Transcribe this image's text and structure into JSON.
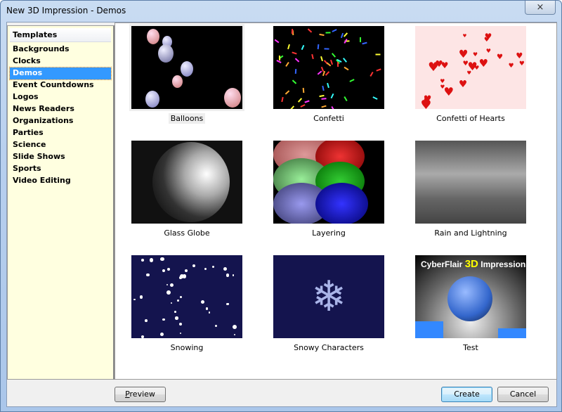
{
  "window": {
    "title": "New 3D Impression - Demos",
    "close_icon": "×"
  },
  "sidebar": {
    "header": "Templates",
    "selected": "Demos",
    "items": [
      {
        "label": "Backgrounds"
      },
      {
        "label": "Clocks"
      },
      {
        "label": "Demos"
      },
      {
        "label": "Event Countdowns"
      },
      {
        "label": "Logos"
      },
      {
        "label": "News Readers"
      },
      {
        "label": "Organizations"
      },
      {
        "label": "Parties"
      },
      {
        "label": "Science"
      },
      {
        "label": "Slide Shows"
      },
      {
        "label": "Sports"
      },
      {
        "label": "Video Editing"
      }
    ]
  },
  "templates": [
    {
      "label": "Balloons"
    },
    {
      "label": "Confetti"
    },
    {
      "label": "Confetti of Hearts"
    },
    {
      "label": "Glass Globe"
    },
    {
      "label": "Layering"
    },
    {
      "label": "Rain and Lightning"
    },
    {
      "label": "Snowing"
    },
    {
      "label": "Snowy Characters"
    },
    {
      "label": "Test"
    }
  ],
  "test_thumb": {
    "brand": "CyberFlair",
    "brand_3d": "3D",
    "brand_suffix": "Impressions"
  },
  "buttons": {
    "preview_key": "P",
    "preview_rest": "review",
    "create": "Create",
    "cancel": "Cancel"
  }
}
